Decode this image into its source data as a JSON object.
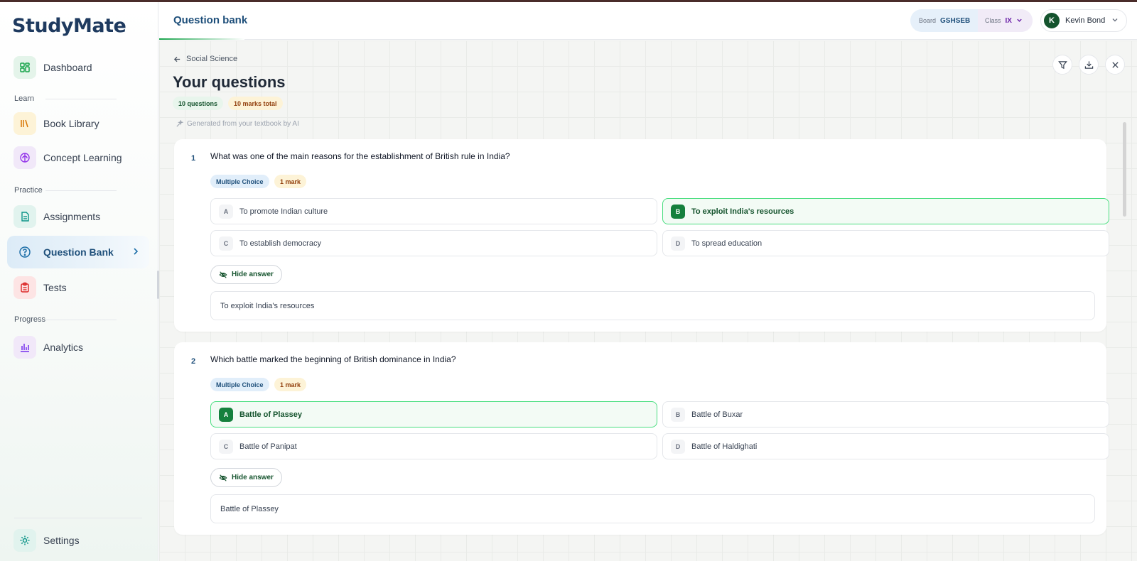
{
  "app": {
    "logo_text": "StudyMate"
  },
  "sidebar": {
    "dashboard": "Dashboard",
    "sections": {
      "learn": "Learn",
      "practice": "Practice",
      "progress": "Progress"
    },
    "book_library": "Book Library",
    "concept_learning": "Concept Learning",
    "assignments": "Assignments",
    "question_bank": "Question Bank",
    "tests": "Tests",
    "analytics": "Analytics",
    "settings": "Settings"
  },
  "header": {
    "title": "Question bank",
    "board_label": "Board",
    "board_value": "GSHSEB",
    "class_label": "Class",
    "class_value": "IX",
    "user_initial": "K",
    "user_name": "Kevin Bond"
  },
  "main": {
    "breadcrumb": "Social Science",
    "title": "Your questions",
    "question_count": "10 questions",
    "marks_total": "10 marks total",
    "ai_note": "Generated from your textbook by AI",
    "questions": [
      {
        "number": "1",
        "text": "What was one of the main reasons for the establishment of British rule in India?",
        "type": "Multiple Choice",
        "marks": "1 mark",
        "options": [
          {
            "letter": "A",
            "text": "To promote Indian culture"
          },
          {
            "letter": "B",
            "text": "To exploit India's resources"
          },
          {
            "letter": "C",
            "text": "To establish democracy"
          },
          {
            "letter": "D",
            "text": "To spread education"
          }
        ],
        "correct": "B",
        "hide_label": "Hide answer",
        "answer": "To exploit India's resources"
      },
      {
        "number": "2",
        "text": "Which battle marked the beginning of British dominance in India?",
        "type": "Multiple Choice",
        "marks": "1 mark",
        "options": [
          {
            "letter": "A",
            "text": "Battle of Plassey"
          },
          {
            "letter": "B",
            "text": "Battle of Buxar"
          },
          {
            "letter": "C",
            "text": "Battle of Panipat"
          },
          {
            "letter": "D",
            "text": "Battle of Haldighati"
          }
        ],
        "correct": "A",
        "hide_label": "Hide answer",
        "answer": "Battle of Plassey"
      }
    ]
  },
  "colors": {
    "accent_blue": "#1e4f7a",
    "correct_green": "#15803d",
    "header_strip": "#4a2c2a"
  }
}
